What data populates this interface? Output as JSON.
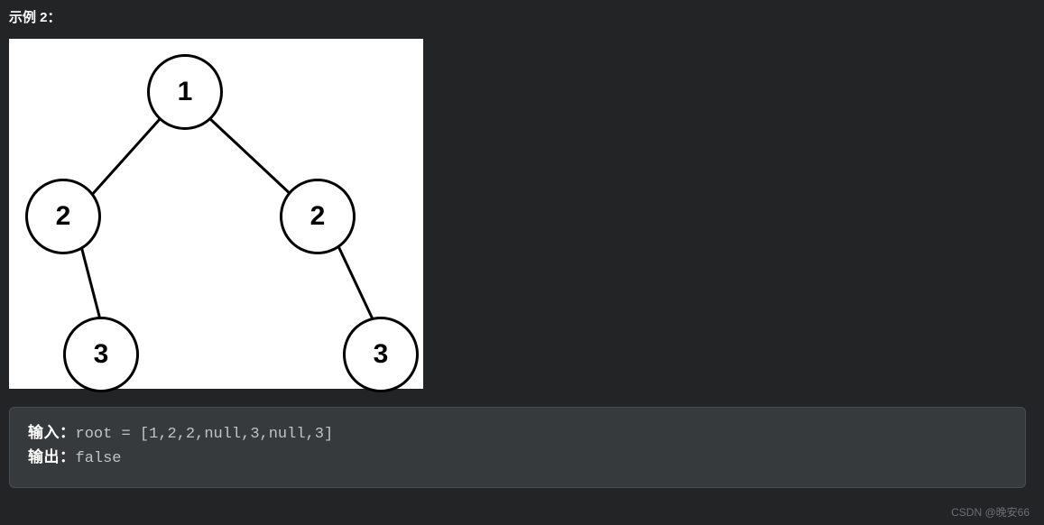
{
  "example": {
    "title": "示例 2：",
    "input_label": "输入：",
    "input_value": "root = [1,2,2,null,3,null,3]",
    "output_label": "输出：",
    "output_value": "false"
  },
  "tree": {
    "nodes": {
      "root": "1",
      "left": "2",
      "right": "2",
      "left_right": "3",
      "right_right": "3"
    }
  },
  "watermark": "CSDN @晚安66",
  "chart_data": {
    "type": "tree",
    "description": "Binary tree diagram",
    "nodes": [
      {
        "id": "n1",
        "value": 1
      },
      {
        "id": "n2",
        "value": 2
      },
      {
        "id": "n3",
        "value": 2
      },
      {
        "id": "n4",
        "value": 3
      },
      {
        "id": "n5",
        "value": 3
      }
    ],
    "edges": [
      {
        "from": "n1",
        "to": "n2",
        "side": "left"
      },
      {
        "from": "n1",
        "to": "n3",
        "side": "right"
      },
      {
        "from": "n2",
        "to": "n4",
        "side": "right"
      },
      {
        "from": "n3",
        "to": "n5",
        "side": "right"
      }
    ],
    "array_representation": [
      1,
      2,
      2,
      null,
      3,
      null,
      3
    ]
  }
}
